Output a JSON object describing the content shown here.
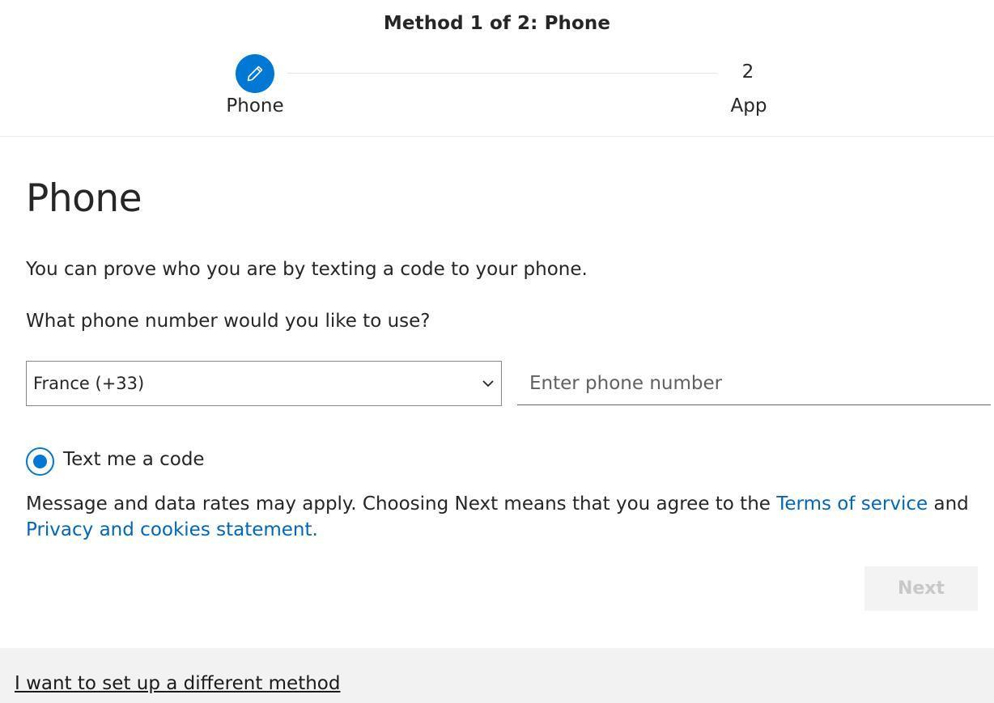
{
  "stepper": {
    "title": "Method 1 of 2: Phone",
    "steps": [
      {
        "label": "Phone",
        "state": "current",
        "icon": "pencil-icon"
      },
      {
        "number": "2",
        "label": "App",
        "state": "pending"
      }
    ]
  },
  "main": {
    "title": "Phone",
    "description": "You can prove who you are by texting a code to your phone.",
    "question": "What phone number would you like to use?",
    "country_select": {
      "value": "France (+33)"
    },
    "phone_input": {
      "placeholder": "Enter phone number",
      "value": ""
    },
    "radio": {
      "label": "Text me a code",
      "checked": true
    },
    "legal": {
      "text_before": "Message and data rates may apply. Choosing Next means that you agree to the ",
      "terms_link": "Terms of service",
      "and": " and ",
      "privacy_link": "Privacy and cookies statement."
    },
    "next_button": {
      "label": "Next",
      "disabled": true
    }
  },
  "footer": {
    "link": "I want to set up a different method"
  },
  "colors": {
    "accent": "#0078d4",
    "link": "#0067b8",
    "footer_bg": "#f2f2f2",
    "disabled_button_bg": "#f3f3f3"
  }
}
